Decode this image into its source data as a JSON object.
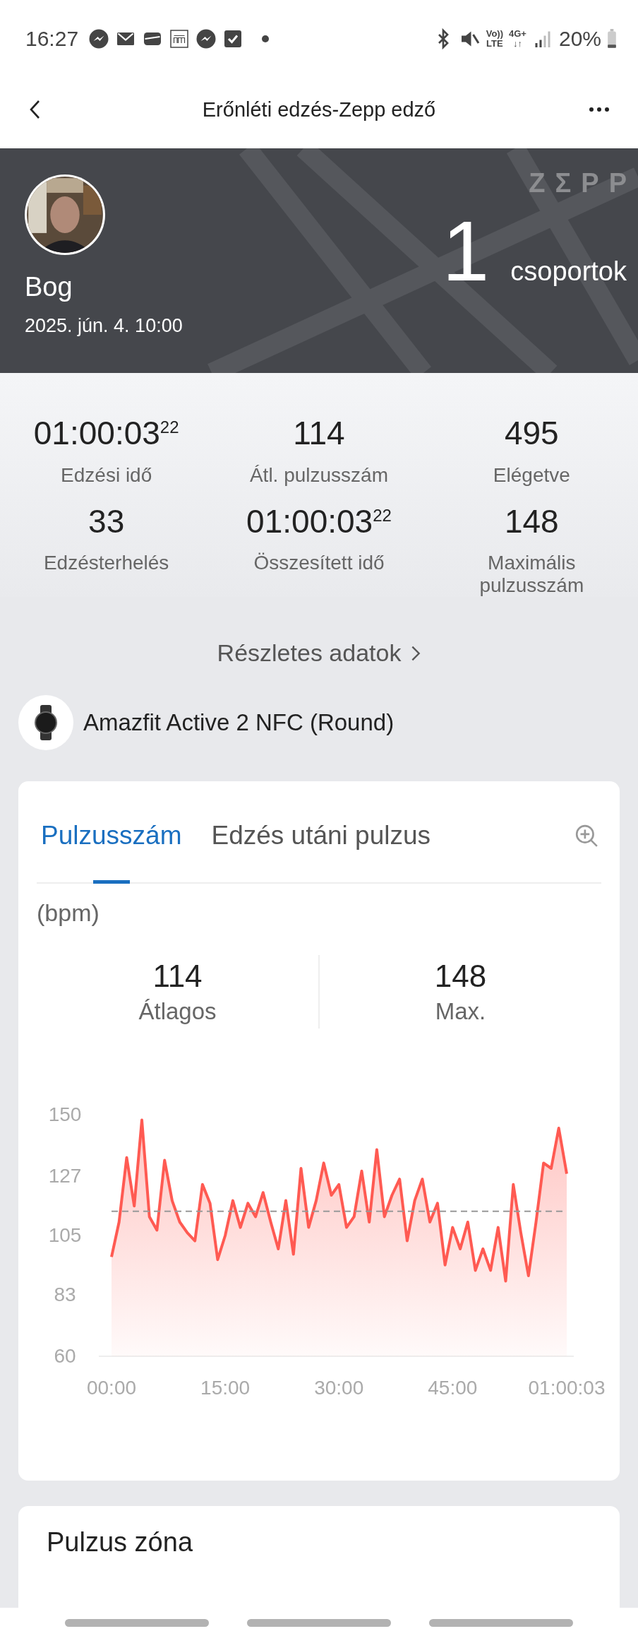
{
  "status_bar": {
    "time": "16:27",
    "network": [
      "Vo))",
      "LTE",
      "4G+",
      "↓↑"
    ],
    "battery": "20%"
  },
  "header": {
    "title": "Erőnléti edzés-Zepp edző"
  },
  "banner": {
    "logo": "ZΣPP",
    "name": "Bog",
    "date": "2025. jún. 4. 10:00",
    "count": "1",
    "count_label": "csoportok"
  },
  "stats": [
    {
      "value": "01:00:03$^{22}$",
      "label": "Edzési idő"
    },
    {
      "value": "114",
      "label": "Átl. pulzusszám"
    },
    {
      "value": "495",
      "label": "Elégetve"
    },
    {
      "value": "33",
      "label": "Edzésterhelés"
    },
    {
      "value": "01:00:03$^{22}$",
      "label": "Összesített idő"
    },
    {
      "value": "148",
      "label": "Maximális pulzusszám"
    }
  ],
  "details_link": "Részletes adatok",
  "device": {
    "name": "Amazfit Active 2 NFC (Round)"
  },
  "heart_card": {
    "tabs": [
      {
        "label": "Pulzusszám",
        "selected": true
      },
      {
        "label": "Edzés utáni pulzus",
        "selected": false
      }
    ],
    "unit": "(bpm)",
    "summary": [
      {
        "value": "114",
        "label": "Átlagos"
      },
      {
        "value": "148",
        "label": "Max."
      }
    ],
    "chart_data": {
      "type": "area",
      "x": [
        0,
        1,
        2,
        3,
        4,
        5,
        6,
        7,
        8,
        9,
        10,
        11,
        12,
        13,
        14,
        15,
        16,
        17,
        18,
        19,
        20,
        21,
        22,
        23,
        24,
        25,
        26,
        27,
        28,
        29,
        30,
        31,
        32,
        33,
        34,
        35,
        36,
        37,
        38,
        39,
        40,
        41,
        42,
        43,
        44,
        45,
        46,
        47,
        48,
        49,
        50,
        51,
        52,
        53,
        54,
        55,
        56,
        57,
        58,
        59,
        60.05
      ],
      "series": [
        {
          "color": "#ff5a52",
          "values": [
            97,
            110,
            134,
            116,
            148,
            112,
            107,
            133,
            118,
            110,
            106,
            103,
            124,
            117,
            96,
            105,
            118,
            108,
            117,
            112,
            121,
            110,
            100,
            118,
            98,
            130,
            108,
            118,
            132,
            120,
            124,
            108,
            112,
            129,
            110,
            137,
            112,
            120,
            126,
            103,
            118,
            126,
            110,
            117,
            94,
            108,
            100,
            110,
            92,
            100,
            92,
            108,
            88,
            124,
            106,
            90,
            110,
            132,
            130,
            145,
            128
          ]
        }
      ],
      "xlim": [
        0,
        60.05
      ],
      "ylim": [
        60,
        150
      ],
      "xticks": [
        {
          "value": 0,
          "label": "00:00"
        },
        {
          "value": 15,
          "label": "15:00"
        },
        {
          "value": 30,
          "label": "30:00"
        },
        {
          "value": 45,
          "label": "45:00"
        },
        {
          "value": 60.05,
          "label": "01:00:03"
        }
      ],
      "yticks": [
        60,
        83,
        105,
        127,
        150
      ],
      "ref_lines": [
        {
          "axis": "y",
          "value": 114
        }
      ]
    }
  },
  "zone_card": {
    "title": "Pulzus zóna"
  }
}
